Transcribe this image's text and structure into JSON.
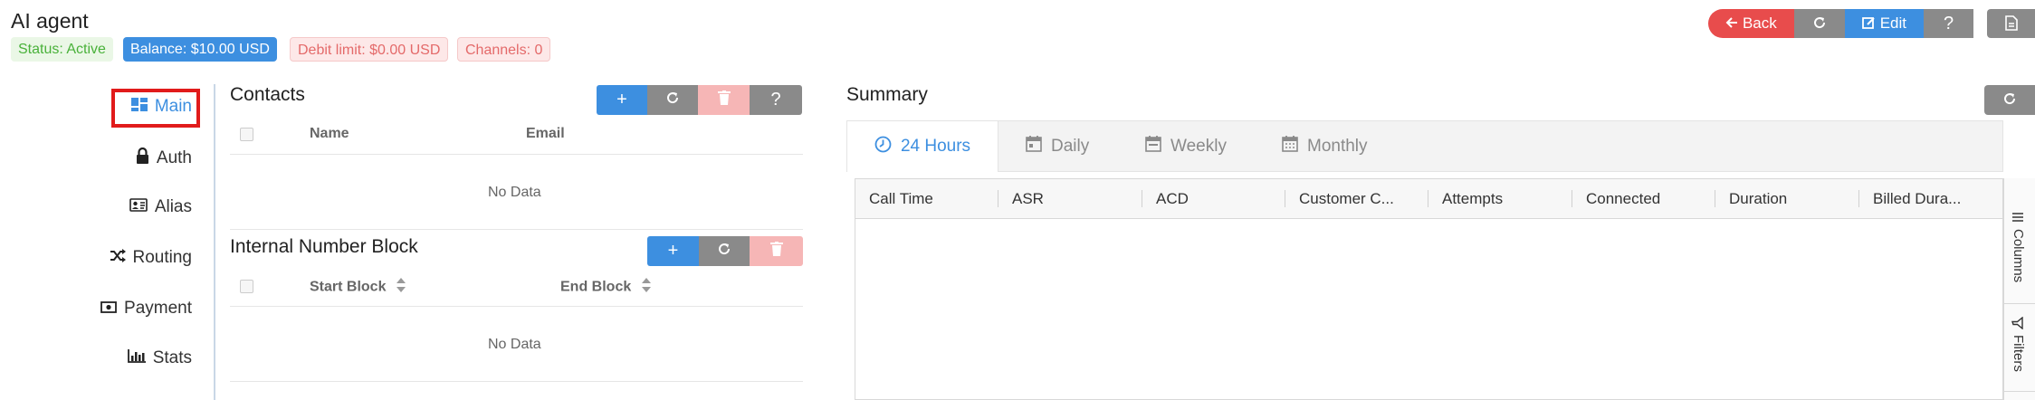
{
  "page": {
    "title": "AI agent"
  },
  "status_badges": {
    "status": "Status: Active",
    "balance": "Balance: $10.00 USD",
    "debit_limit": "Debit limit: $0.00 USD",
    "channels": "Channels: 0"
  },
  "toolbar": {
    "back_label": "Back",
    "edit_label": "Edit",
    "help_label": "?"
  },
  "sidebar": {
    "items": [
      {
        "label": "Main",
        "icon": "dashboard-icon",
        "active": true
      },
      {
        "label": "Auth",
        "icon": "lock-icon"
      },
      {
        "label": "Alias",
        "icon": "id-card-icon"
      },
      {
        "label": "Routing",
        "icon": "shuffle-icon"
      },
      {
        "label": "Payment",
        "icon": "money-icon"
      },
      {
        "label": "Stats",
        "icon": "bar-chart-icon"
      }
    ]
  },
  "contacts": {
    "title": "Contacts",
    "columns": [
      "Name",
      "Email"
    ],
    "empty_text": "No Data",
    "buttons": {
      "add": "+",
      "help": "?"
    }
  },
  "number_block": {
    "title": "Internal Number Block",
    "columns": [
      "Start Block",
      "End Block"
    ],
    "empty_text": "No Data",
    "buttons": {
      "add": "+"
    }
  },
  "summary": {
    "title": "Summary",
    "tabs": [
      {
        "label": "24 Hours",
        "icon": "clock-icon",
        "active": true
      },
      {
        "label": "Daily",
        "icon": "calendar-day-icon"
      },
      {
        "label": "Weekly",
        "icon": "calendar-week-icon"
      },
      {
        "label": "Monthly",
        "icon": "calendar-month-icon"
      }
    ],
    "columns": [
      "Call Time",
      "ASR",
      "ACD",
      "Customer C...",
      "Attempts",
      "Connected",
      "Duration",
      "Billed Dura..."
    ],
    "side_tabs": [
      "Columns",
      "Filters"
    ]
  },
  "colors": {
    "primary": "#3d8fe0",
    "danger": "#e84c4c",
    "secondary": "#8a8a8a",
    "highlight": "#e11b1b"
  }
}
